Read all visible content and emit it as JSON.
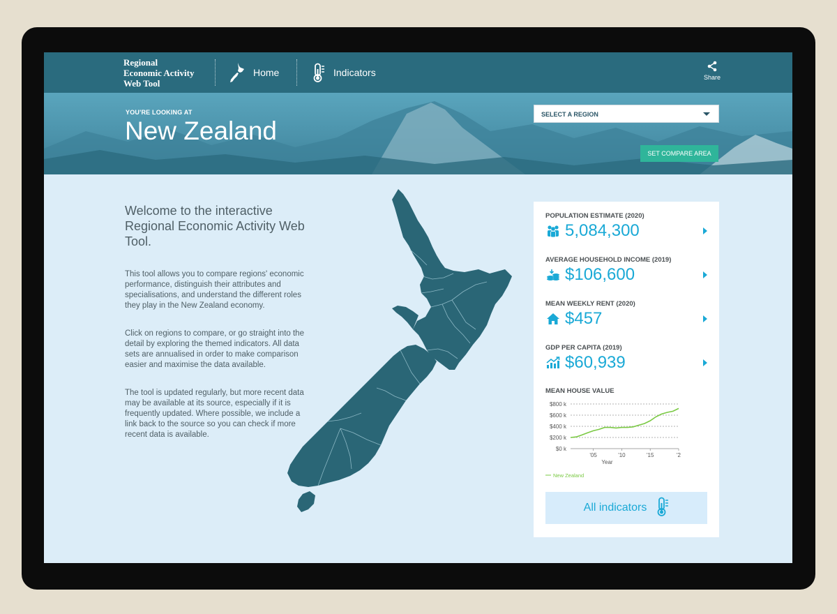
{
  "nav": {
    "brand_line1": "Regional",
    "brand_line2": "Economic Activity",
    "brand_line3": "Web Tool",
    "home_label": "Home",
    "indicators_label": "Indicators",
    "share_label": "Share"
  },
  "hero": {
    "kicker": "YOU'RE LOOKING AT",
    "title": "New Zealand",
    "select_placeholder": "SELECT A REGION",
    "compare_label": "SET COMPARE AREA"
  },
  "intro": {
    "heading": "Welcome to the interactive Regional Economic Activity Web Tool.",
    "p1": "This tool allows you to compare regions' economic performance, distinguish their attributes and specialisations, and understand the different roles they play in the New Zealand economy.",
    "p2": "Click on regions to compare, or go straight into the detail by exploring the themed indicators. All data sets are annualised in order to make comparison easier and maximise the data available.",
    "p3": "The tool is updated regularly, but more recent data may be available at its source, especially if it is frequently updated. Where possible, we include a link back to the source so you can check if more recent data is available."
  },
  "stats": [
    {
      "label": "POPULATION ESTIMATE (2020)",
      "value": "5,084,300",
      "icon": "people-icon"
    },
    {
      "label": "AVERAGE HOUSEHOLD INCOME (2019)",
      "value": "$106,600",
      "icon": "coins-icon"
    },
    {
      "label": "MEAN WEEKLY RENT (2020)",
      "value": "$457",
      "icon": "house-icon"
    },
    {
      "label": "GDP PER CAPITA (2019)",
      "value": "$60,939",
      "icon": "growth-chart-icon"
    }
  ],
  "chart_title": "MEAN HOUSE VALUE",
  "all_indicators_label": "All indicators",
  "colors": {
    "nav_bg": "#2a6b7e",
    "accent": "#1aa9d6",
    "compare_button": "#2fb59a",
    "map_fill": "#2a6676",
    "chart_line": "#7ac943"
  },
  "chart_data": {
    "type": "line",
    "title": "MEAN HOUSE VALUE",
    "xlabel": "Year",
    "ylabel": "",
    "x_ticks": [
      "'05",
      "'10",
      "'15",
      "'2"
    ],
    "y_ticks": [
      "$0 k",
      "$200 k",
      "$400 k",
      "$600 k",
      "$800 k"
    ],
    "xlim": [
      2001,
      2020
    ],
    "ylim": [
      0,
      800
    ],
    "series": [
      {
        "name": "New Zealand",
        "x": [
          2001,
          2002,
          2003,
          2004,
          2005,
          2006,
          2007,
          2008,
          2009,
          2010,
          2011,
          2012,
          2013,
          2014,
          2015,
          2016,
          2017,
          2018,
          2019,
          2020
        ],
        "values": [
          200,
          210,
          245,
          285,
          320,
          345,
          380,
          380,
          370,
          380,
          380,
          390,
          420,
          450,
          500,
          570,
          620,
          650,
          670,
          720
        ]
      }
    ],
    "legend": "bottom-left",
    "grid": true
  }
}
